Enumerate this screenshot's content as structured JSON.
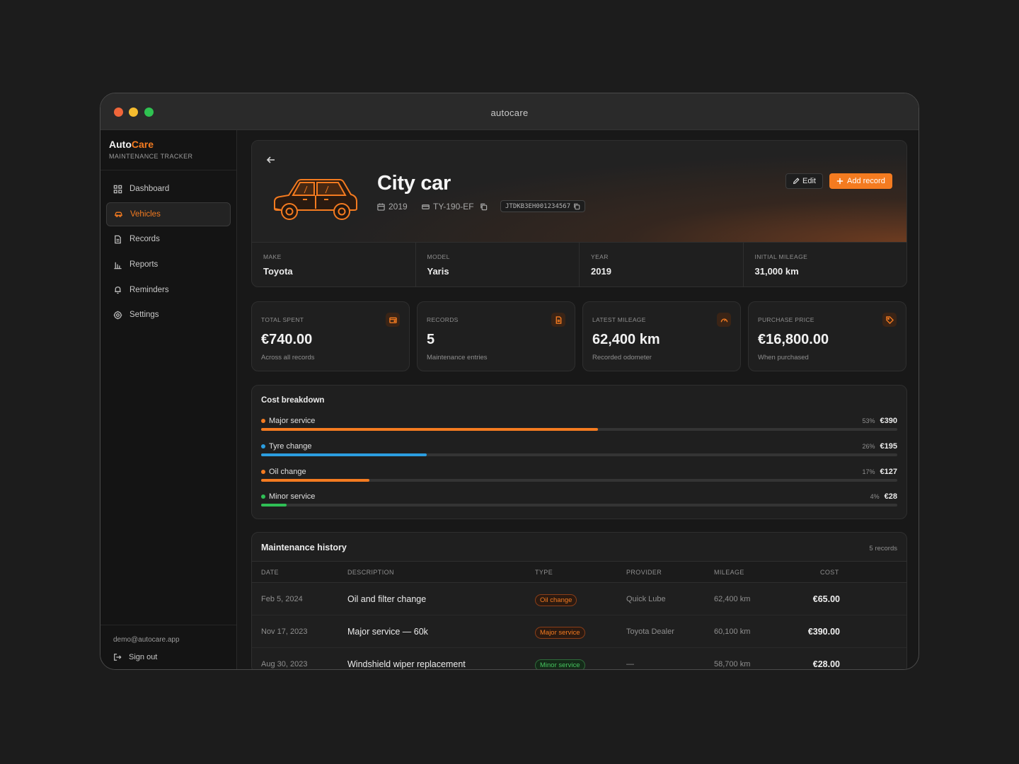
{
  "window": {
    "title": "autocare"
  },
  "brand": {
    "name_part1": "Auto",
    "name_part2": "Care",
    "subtitle": "MAINTENANCE TRACKER"
  },
  "nav": [
    {
      "label": "Dashboard",
      "icon": "grid-icon",
      "active": false
    },
    {
      "label": "Vehicles",
      "icon": "car-icon",
      "active": true
    },
    {
      "label": "Records",
      "icon": "file-icon",
      "active": false
    },
    {
      "label": "Reports",
      "icon": "bar-chart-icon",
      "active": false
    },
    {
      "label": "Reminders",
      "icon": "bell-icon",
      "active": false
    },
    {
      "label": "Settings",
      "icon": "gear-icon",
      "active": false
    }
  ],
  "user": {
    "email": "demo@autocare.app",
    "signout_label": "Sign out"
  },
  "vehicle": {
    "name": "City car",
    "year": "2019",
    "plate": "TY-190-EF",
    "vin": "JTDKB3EH001234567",
    "edit_label": "Edit",
    "add_label": "Add record",
    "specs": [
      {
        "label": "MAKE",
        "value": "Toyota"
      },
      {
        "label": "MODEL",
        "value": "Yaris"
      },
      {
        "label": "YEAR",
        "value": "2019"
      },
      {
        "label": "INITIAL MILEAGE",
        "value": "31,000 km"
      }
    ]
  },
  "stats": [
    {
      "label": "TOTAL SPENT",
      "value": "€740.00",
      "sub": "Across all records",
      "icon": "wallet-icon"
    },
    {
      "label": "RECORDS",
      "value": "5",
      "sub": "Maintenance entries",
      "icon": "document-icon"
    },
    {
      "label": "LATEST MILEAGE",
      "value": "62,400 km",
      "sub": "Recorded odometer",
      "icon": "gauge-icon"
    },
    {
      "label": "PURCHASE PRICE",
      "value": "€16,800.00",
      "sub": "When purchased",
      "icon": "tag-icon"
    }
  ],
  "breakdown": {
    "title": "Cost breakdown",
    "items": [
      {
        "name": "Major service",
        "pct": "53%",
        "amount": "€390",
        "fraction": 0.53,
        "color": "#f47b20"
      },
      {
        "name": "Tyre change",
        "pct": "26%",
        "amount": "€195",
        "fraction": 0.26,
        "color": "#2b9ee0"
      },
      {
        "name": "Oil change",
        "pct": "17%",
        "amount": "€127",
        "fraction": 0.17,
        "color": "#f47b20"
      },
      {
        "name": "Minor service",
        "pct": "4%",
        "amount": "€28",
        "fraction": 0.04,
        "color": "#2fbf55"
      }
    ]
  },
  "history": {
    "title": "Maintenance history",
    "count": "5 records",
    "columns": [
      "DATE",
      "DESCRIPTION",
      "TYPE",
      "PROVIDER",
      "MILEAGE",
      "COST"
    ],
    "rows": [
      {
        "date": "Feb 5, 2024",
        "description": "Oil and filter change",
        "type": "Oil change",
        "type_color": "orange",
        "provider": "Quick Lube",
        "mileage": "62,400 km",
        "cost": "€65.00"
      },
      {
        "date": "Nov 17, 2023",
        "description": "Major service — 60k",
        "type": "Major service",
        "type_color": "orange",
        "provider": "Toyota Dealer",
        "mileage": "60,100 km",
        "cost": "€390.00"
      },
      {
        "date": "Aug 30, 2023",
        "description": "Windshield wiper replacement",
        "type": "Minor service",
        "type_color": "green",
        "provider": "—",
        "mileage": "58,700 km",
        "cost": "€28.00"
      }
    ]
  }
}
